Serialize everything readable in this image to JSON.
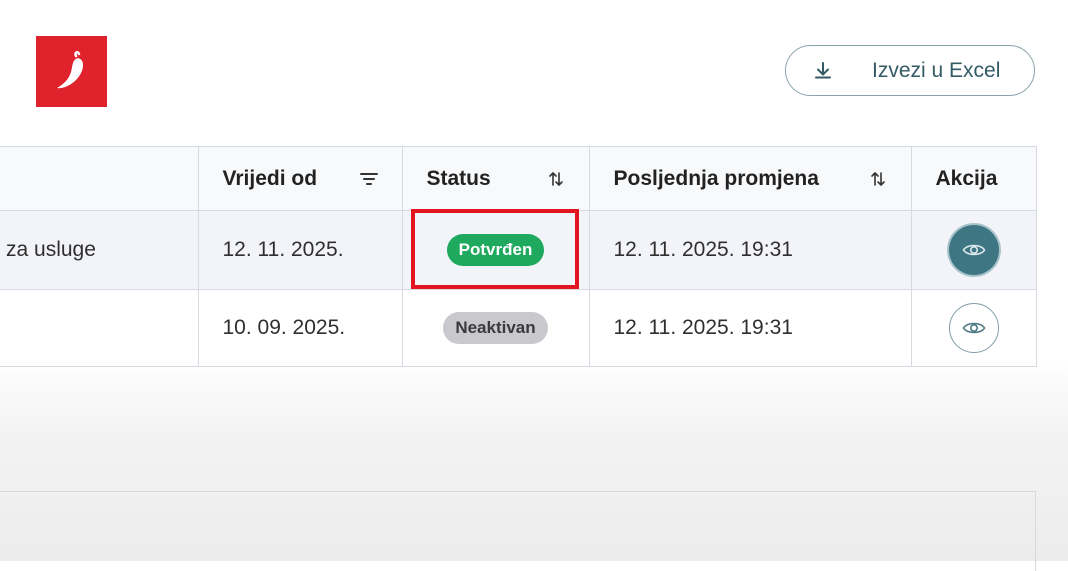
{
  "header": {
    "logo_icon": "chili-pepper-icon",
    "brand_color": "#e0222d",
    "export_button": {
      "label": "Izvezi u Excel",
      "icon": "download-icon"
    }
  },
  "table": {
    "columns": [
      {
        "label": "",
        "sort_icon": ""
      },
      {
        "label": "Vrijedi od",
        "sort_icon": "filter-lines-icon"
      },
      {
        "label": "Status",
        "sort_icon": "sort-arrows-icon"
      },
      {
        "label": "Posljednja promjena",
        "sort_icon": "sort-arrows-icon"
      },
      {
        "label": "Akcija",
        "sort_icon": ""
      }
    ],
    "rows": [
      {
        "name": "za usluge",
        "valid_from": "12. 11. 2025.",
        "status": "Potvrđen",
        "status_color": "#1fa95e",
        "last_change": "12. 11. 2025. 19:31",
        "action_icon": "eye-icon",
        "highlighted": true
      },
      {
        "name": "",
        "valid_from": "10. 09. 2025.",
        "status": "Neaktivan",
        "status_color": "#c9c9cd",
        "last_change": "12. 11. 2025. 19:31",
        "action_icon": "eye-icon",
        "highlighted": false
      }
    ]
  }
}
